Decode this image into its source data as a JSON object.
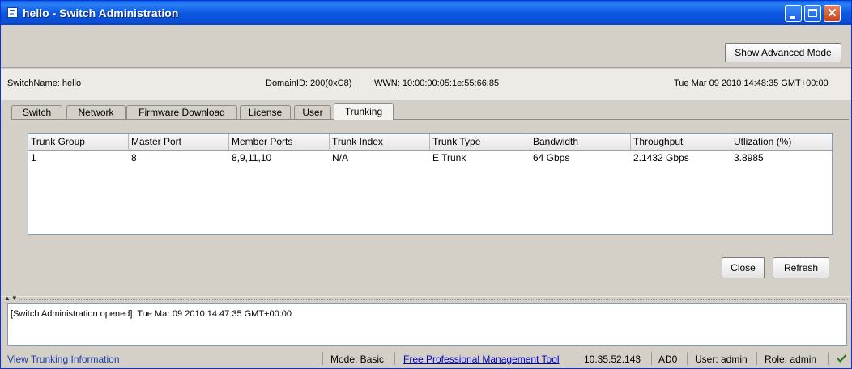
{
  "window": {
    "title": "hello - Switch Administration",
    "controls": {
      "minimize": "minimize",
      "maximize": "maximize",
      "close": "✕"
    }
  },
  "toolbar": {
    "advanced_mode_label": "Show Advanced Mode"
  },
  "info": {
    "switch_name": "SwitchName: hello",
    "domain_id": "DomainID: 200(0xC8)",
    "wwn": "WWN: 10:00:00:05:1e:55:66:85",
    "datetime": "Tue Mar 09 2010 14:48:35 GMT+00:00"
  },
  "tabs": [
    {
      "label": "Switch"
    },
    {
      "label": "Network"
    },
    {
      "label": "Firmware Download"
    },
    {
      "label": "License"
    },
    {
      "label": "User"
    },
    {
      "label": "Trunking",
      "active": true
    }
  ],
  "table": {
    "columns": [
      "Trunk Group",
      "Master Port",
      "Member Ports",
      "Trunk Index",
      "Trunk Type",
      "Bandwidth",
      "Throughput",
      "Utlization (%)"
    ],
    "rows": [
      [
        "1",
        "8",
        "8,9,11,10",
        "N/A",
        "E Trunk",
        "64 Gbps",
        "2.1432 Gbps",
        "3.8985"
      ]
    ]
  },
  "actions": {
    "close_label": "Close",
    "refresh_label": "Refresh"
  },
  "splitter": {
    "arrows": "▲▼"
  },
  "log": {
    "message": "[Switch Administration opened]: Tue Mar 09 2010 14:47:35 GMT+00:00"
  },
  "status": {
    "view_info": "View Trunking Information",
    "mode": "Mode: Basic",
    "mgmt_link": "Free Professional Management Tool",
    "ip": "10.35.52.143",
    "ad": "AD0",
    "user": "User: admin",
    "role": "Role: admin",
    "status_icon": "check-icon",
    "accent_color": "#2e7d1a"
  }
}
